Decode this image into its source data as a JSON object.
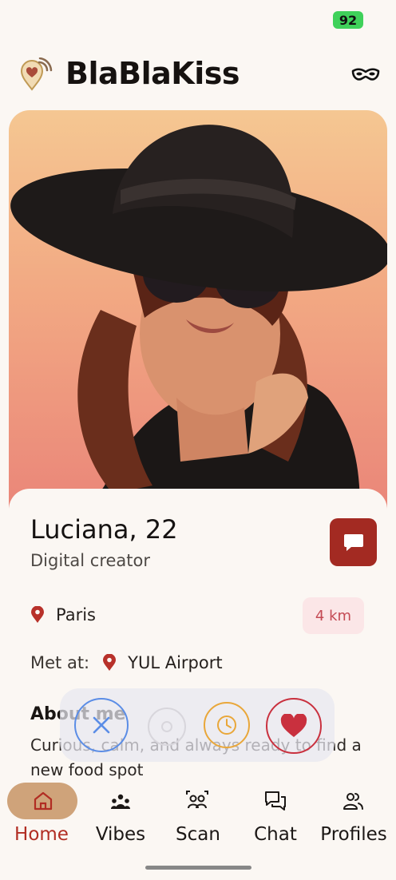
{
  "status_bar": {
    "battery": "92"
  },
  "header": {
    "title": "BlaBlaKiss",
    "logo_icon": "location-heart-icon",
    "menu_icon": "mask-icon"
  },
  "profile": {
    "name_age": "Luciana, 22",
    "occupation": "Digital creator",
    "city": "Paris",
    "distance": "4 km",
    "met_at_label": "Met at:",
    "met_at_place": "YUL Airport",
    "about_title": "About me",
    "about_text": "Curious, calm, and always ready to find a new food spot"
  },
  "actions": [
    {
      "name": "pass",
      "icon": "close-icon",
      "color": "#5b8de6"
    },
    {
      "name": "rewind",
      "icon": "rewind-icon",
      "color": "#d8d6dc"
    },
    {
      "name": "later",
      "icon": "clock-icon",
      "color": "#e9a73a"
    },
    {
      "name": "like",
      "icon": "heart-icon",
      "color": "#c9303e"
    }
  ],
  "nav": {
    "items": [
      {
        "label": "Home",
        "icon": "home-icon",
        "active": true
      },
      {
        "label": "Vibes",
        "icon": "vibes-icon",
        "active": false
      },
      {
        "label": "Scan",
        "icon": "scan-icon",
        "active": false
      },
      {
        "label": "Chat",
        "icon": "chat-icon",
        "active": false
      },
      {
        "label": "Profiles",
        "icon": "profiles-icon",
        "active": false
      }
    ]
  },
  "colors": {
    "accent": "#a32a22",
    "nav_active_pill": "#cfa37a",
    "distance_text": "#c44a54",
    "background": "#fbf7f3"
  }
}
